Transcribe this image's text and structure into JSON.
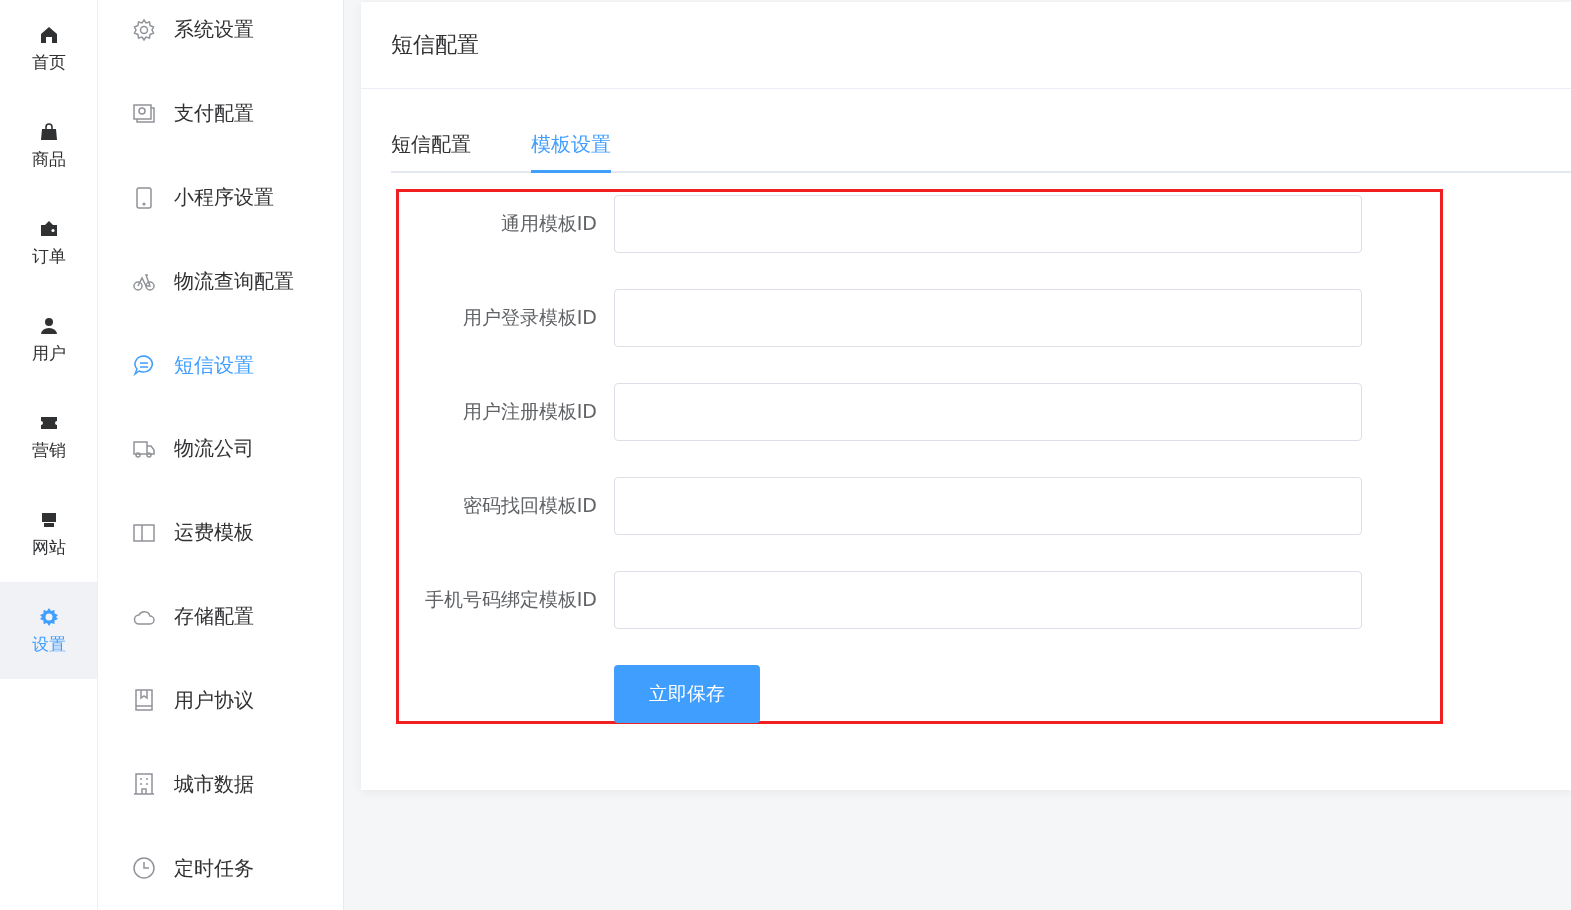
{
  "rail": [
    {
      "label": "首页",
      "selected": false
    },
    {
      "label": "商品",
      "selected": false
    },
    {
      "label": "订单",
      "selected": false
    },
    {
      "label": "用户",
      "selected": false
    },
    {
      "label": "营销",
      "selected": false
    },
    {
      "label": "网站",
      "selected": false
    },
    {
      "label": "设置",
      "selected": true
    }
  ],
  "menu": [
    {
      "label": "系统设置",
      "selected": false
    },
    {
      "label": "支付配置",
      "selected": false
    },
    {
      "label": "小程序设置",
      "selected": false
    },
    {
      "label": "物流查询配置",
      "selected": false
    },
    {
      "label": "短信设置",
      "selected": true
    },
    {
      "label": "物流公司",
      "selected": false
    },
    {
      "label": "运费模板",
      "selected": false
    },
    {
      "label": "存储配置",
      "selected": false
    },
    {
      "label": "用户协议",
      "selected": false
    },
    {
      "label": "城市数据",
      "selected": false
    },
    {
      "label": "定时任务",
      "selected": false
    }
  ],
  "card": {
    "title": "短信配置"
  },
  "tabs": [
    {
      "label": "短信配置",
      "selected": false
    },
    {
      "label": "模板设置",
      "selected": true
    }
  ],
  "form": {
    "fields": [
      {
        "label": "通用模板ID"
      },
      {
        "label": "用户登录模板ID"
      },
      {
        "label": "用户注册模板ID"
      },
      {
        "label": "密码找回模板ID"
      },
      {
        "label": "手机号码绑定模板ID"
      }
    ],
    "submit": "立即保存"
  }
}
